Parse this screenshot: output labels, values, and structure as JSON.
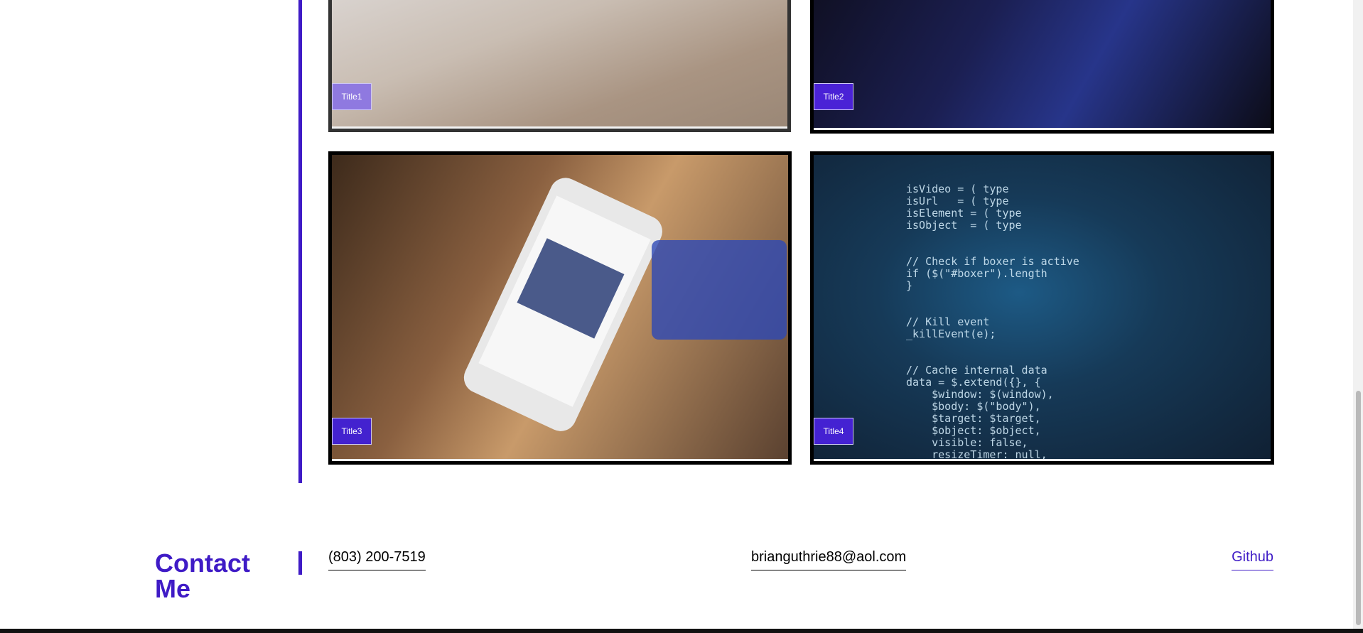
{
  "gallery": {
    "items": [
      {
        "title": "Title1"
      },
      {
        "title": "Title2"
      },
      {
        "title": "Title3"
      },
      {
        "title": "Title4"
      }
    ]
  },
  "contact": {
    "heading": "Contact Me",
    "phone": "(803) 200-7519",
    "email": "brianguthrie88@aol.com",
    "github": "Github"
  },
  "colors": {
    "accent": "#3f1bc6"
  }
}
